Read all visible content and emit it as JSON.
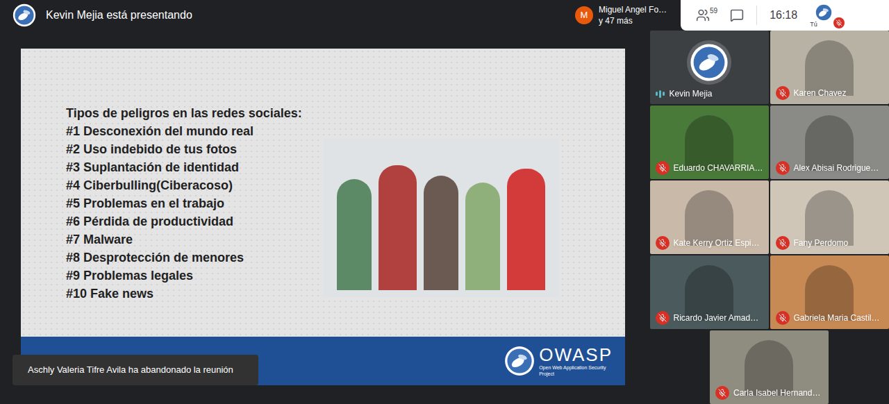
{
  "header": {
    "presenter_text": "Kevin Mejia está presentando",
    "participants_chip": {
      "initial": "M",
      "name": "Miguel Angel Fo…",
      "more": "y 47 más"
    },
    "participant_count": "59",
    "time": "16:18",
    "self_label": "Tú",
    "self_muted": true
  },
  "slide": {
    "heading": "Tipos de peligros en las redes sociales:",
    "items": [
      "#1 Desconexión del mundo real",
      "#2 Uso indebido de tus fotos",
      "#3 Suplantación de identidad",
      "#4 Ciberbulling(Ciberacoso)",
      "#5 Problemas en el trabajo",
      "#6 Pérdida de productividad",
      "#7 Malware",
      "#8 Desprotección de menores",
      "#9 Problemas legales",
      "#10 Fake news"
    ],
    "logo_text": "OWASP",
    "logo_sub": "Open Web Application Security Project"
  },
  "tiles": [
    {
      "name": "Kevin Mejia",
      "kind": "avatar",
      "muted": false,
      "speaking": true
    },
    {
      "name": "Karen Chavez",
      "kind": "video",
      "muted": true,
      "speaking": false
    },
    {
      "name": "Eduardo CHAVARRIA…",
      "kind": "video",
      "muted": true,
      "speaking": false
    },
    {
      "name": "Alex Abisai Rodrigue…",
      "kind": "video",
      "muted": true,
      "speaking": false
    },
    {
      "name": "Kate Kerry Ortiz Espi…",
      "kind": "video",
      "muted": true,
      "speaking": false
    },
    {
      "name": "Fany Perdomo",
      "kind": "video",
      "muted": true,
      "speaking": false
    },
    {
      "name": "Ricardo Javier Amad…",
      "kind": "video",
      "muted": true,
      "speaking": false
    },
    {
      "name": "Gabriela Maria Castil…",
      "kind": "video",
      "muted": true,
      "speaking": false
    },
    {
      "name": "Carla Isabel Hernand…",
      "kind": "video",
      "muted": true,
      "speaking": false
    }
  ],
  "toast": "Aschly Valeria Tifre Avila ha abandonado la reunión"
}
